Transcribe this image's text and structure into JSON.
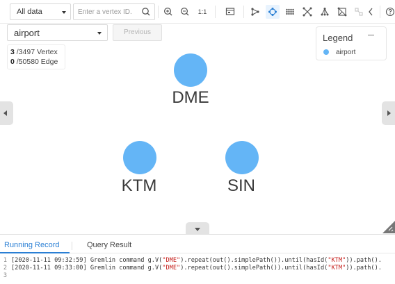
{
  "toolbar": {
    "data_filter": "All data",
    "search_placeholder": "Enter a vertex ID.",
    "zoom_reset_label": "1:1"
  },
  "filter": {
    "vertex_type": "airport",
    "previous_label": "Previous"
  },
  "stats": {
    "vertex_shown": "3",
    "vertex_total": "/3497 Vertex",
    "edge_shown": "0",
    "edge_total": "/50580 Edge"
  },
  "legend": {
    "title": "Legend",
    "items": [
      {
        "label": "airport",
        "color": "#64b5f6"
      }
    ]
  },
  "graph": {
    "node_color": "#64b5f6",
    "nodes": [
      {
        "label": "DME"
      },
      {
        "label": "KTM"
      },
      {
        "label": "SIN"
      }
    ]
  },
  "panel": {
    "tabs": [
      {
        "label": "Running Record"
      },
      {
        "label": "Query Result"
      }
    ],
    "log": [
      {
        "num": "1",
        "prefix": "[2020-11-11 09:32:59] Gremlin command g.V(",
        "s1": "\"DME\"",
        "mid": ").repeat(out().simplePath()).until(hasId(",
        "s2": "\"KTM\"",
        "suffix": ")).path()."
      },
      {
        "num": "2",
        "prefix": "[2020-11-11 09:33:00] Gremlin command g.V(",
        "s1": "\"DME\"",
        "mid": ").repeat(out().simplePath()).until(hasId(",
        "s2": "\"KTM\"",
        "suffix": ")).path()."
      },
      {
        "num": "3",
        "prefix": "",
        "s1": "",
        "mid": "",
        "s2": "",
        "suffix": ""
      }
    ]
  }
}
